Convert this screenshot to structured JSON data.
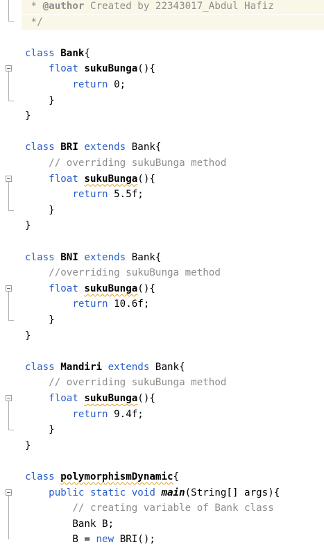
{
  "lines": [
    {
      "parts": [
        {
          "t": " * ",
          "c": "doc-txt"
        },
        {
          "t": "@author",
          "c": "tag"
        },
        {
          "t": " Created by 22343017_Abdul Hafiz",
          "c": "doc-txt"
        }
      ],
      "doc": true
    },
    {
      "parts": [
        {
          "t": " */",
          "c": "doc-txt"
        }
      ],
      "doc": true
    },
    {
      "parts": []
    },
    {
      "parts": [
        {
          "t": "class ",
          "c": "kw"
        },
        {
          "t": "Bank",
          "c": "cls"
        },
        {
          "t": "{"
        }
      ]
    },
    {
      "parts": [
        {
          "t": "    "
        },
        {
          "t": "float ",
          "c": "kw"
        },
        {
          "t": "sukuBunga",
          "c": "cls"
        },
        {
          "t": "(){"
        }
      ]
    },
    {
      "parts": [
        {
          "t": "        "
        },
        {
          "t": "return ",
          "c": "kw"
        },
        {
          "t": "0;"
        }
      ]
    },
    {
      "parts": [
        {
          "t": "    }"
        }
      ]
    },
    {
      "parts": [
        {
          "t": "}"
        }
      ]
    },
    {
      "parts": []
    },
    {
      "parts": [
        {
          "t": "class ",
          "c": "kw"
        },
        {
          "t": "BRI",
          "c": "cls"
        },
        {
          "t": " extends ",
          "c": "kw"
        },
        {
          "t": "Bank{"
        }
      ]
    },
    {
      "parts": [
        {
          "t": "    "
        },
        {
          "t": "// overriding sukuBunga method",
          "c": "cmt"
        }
      ]
    },
    {
      "parts": [
        {
          "t": "    "
        },
        {
          "t": "float ",
          "c": "kw"
        },
        {
          "t": "sukuBunga",
          "c": "cls squig"
        },
        {
          "t": "(){"
        }
      ]
    },
    {
      "parts": [
        {
          "t": "        "
        },
        {
          "t": "return ",
          "c": "kw"
        },
        {
          "t": "5.5f;"
        }
      ]
    },
    {
      "parts": [
        {
          "t": "    }"
        }
      ]
    },
    {
      "parts": [
        {
          "t": "}"
        }
      ]
    },
    {
      "parts": []
    },
    {
      "parts": [
        {
          "t": "class ",
          "c": "kw"
        },
        {
          "t": "BNI",
          "c": "cls"
        },
        {
          "t": " extends ",
          "c": "kw"
        },
        {
          "t": "Bank{"
        }
      ]
    },
    {
      "parts": [
        {
          "t": "    "
        },
        {
          "t": "//overriding sukuBunga method",
          "c": "cmt"
        }
      ]
    },
    {
      "parts": [
        {
          "t": "    "
        },
        {
          "t": "float ",
          "c": "kw"
        },
        {
          "t": "sukuBunga",
          "c": "cls squig"
        },
        {
          "t": "(){"
        }
      ]
    },
    {
      "parts": [
        {
          "t": "        "
        },
        {
          "t": "return ",
          "c": "kw"
        },
        {
          "t": "10.6f;"
        }
      ]
    },
    {
      "parts": [
        {
          "t": "    }"
        }
      ]
    },
    {
      "parts": [
        {
          "t": "}"
        }
      ]
    },
    {
      "parts": []
    },
    {
      "parts": [
        {
          "t": "class ",
          "c": "kw"
        },
        {
          "t": "Mandiri",
          "c": "cls"
        },
        {
          "t": " extends ",
          "c": "kw"
        },
        {
          "t": "Bank{"
        }
      ]
    },
    {
      "parts": [
        {
          "t": "    "
        },
        {
          "t": "// overriding sukuBunga method",
          "c": "cmt"
        }
      ]
    },
    {
      "parts": [
        {
          "t": "    "
        },
        {
          "t": "float ",
          "c": "kw"
        },
        {
          "t": "sukuBunga",
          "c": "cls squig"
        },
        {
          "t": "(){"
        }
      ]
    },
    {
      "parts": [
        {
          "t": "        "
        },
        {
          "t": "return ",
          "c": "kw"
        },
        {
          "t": "9.4f;"
        }
      ]
    },
    {
      "parts": [
        {
          "t": "    }"
        }
      ]
    },
    {
      "parts": [
        {
          "t": "}"
        }
      ]
    },
    {
      "parts": []
    },
    {
      "parts": [
        {
          "t": "class ",
          "c": "kw"
        },
        {
          "t": "polymorphismDynamic",
          "c": "cls squig"
        },
        {
          "t": "{"
        }
      ]
    },
    {
      "parts": [
        {
          "t": "    "
        },
        {
          "t": "public static void ",
          "c": "kw"
        },
        {
          "t": "main",
          "c": "ital"
        },
        {
          "t": "(String[] args){"
        }
      ]
    },
    {
      "parts": [
        {
          "t": "        "
        },
        {
          "t": "// creating variable of Bank class",
          "c": "cmt"
        }
      ]
    },
    {
      "parts": [
        {
          "t": "        "
        },
        {
          "t": "Bank B;"
        }
      ]
    },
    {
      "parts": [
        {
          "t": "        "
        },
        {
          "t": "B = "
        },
        {
          "t": "new ",
          "c": "kw"
        },
        {
          "t": "BRI();"
        }
      ]
    }
  ]
}
